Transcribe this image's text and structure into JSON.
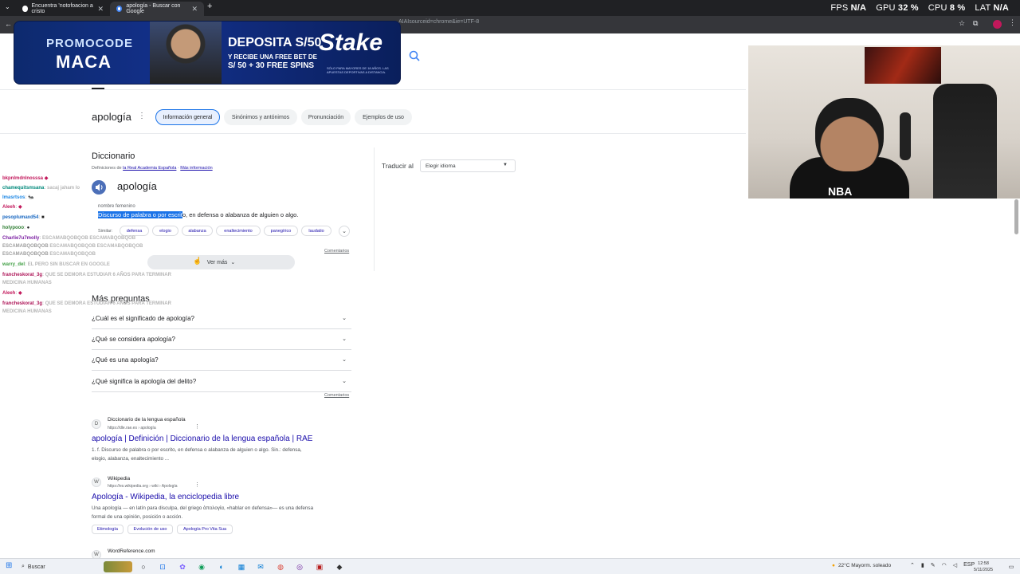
{
  "browser": {
    "tabs": [
      {
        "title": "Encuentra 'notofoacion a cristo",
        "active": false
      },
      {
        "title": "apología - Buscar con Google",
        "active": true
      }
    ],
    "url_fragment": "AIAIsourceid=chrome&ie=UTF-8"
  },
  "stats": {
    "fps_label": "FPS",
    "fps_value": "N/A",
    "gpu_label": "GPU",
    "gpu_value": "32 %",
    "cpu_label": "CPU",
    "cpu_value": "8 %",
    "lat_label": "LAT",
    "lat_value": "N/A"
  },
  "ad": {
    "promo_line1": "PROMOCODE",
    "promo_line2": "MACA",
    "deposit": "DEPOSITA S/50",
    "bonus_line1": "Y RECIBE UNA FREE BET DE",
    "bonus_line2": "S/ 50 + 30 FREE SPINS",
    "brand": "Stake",
    "fine_print": "SÓLO PARA MAYORES DE 18 AÑOS. LAS APUESTAS DEPORTIVAS A DISTANCIA."
  },
  "search": {
    "query": "apología",
    "chips": [
      "Información general",
      "Sinónimos y antónimos",
      "Pronunciación",
      "Ejemplos de uso"
    ],
    "selected_chip": "Información general"
  },
  "dictionary": {
    "title": "Diccionario",
    "source_prefix": "Definiciones de",
    "source_link": "la Real Academia Española",
    "more_info": "Más información",
    "headword": "apología",
    "part_of_speech": "nombre femenino",
    "definition_highlight": "Discurso de palabra o por escrit",
    "definition_rest": "o, en defensa o alabanza de alguien o algo.",
    "similar_label": "Similar:",
    "synonyms": [
      "defensa",
      "elogio",
      "alabanza",
      "enaltecimiento",
      "panegírico",
      "laudatio"
    ],
    "comments": "Comentarios",
    "see_more": "Ver más"
  },
  "translate": {
    "label": "Traducir al",
    "placeholder": "Elegir idioma"
  },
  "more_questions": {
    "title": "Más preguntas",
    "items": [
      "¿Cuál es el significado de apología?",
      "¿Qué se considera apología?",
      "¿Qué es una apología?",
      "¿Qué significa la apología del delito?"
    ],
    "comments": "Comentarios"
  },
  "results": [
    {
      "site": "Diccionario de la lengua española",
      "url": "https://dle.rae.es › apología",
      "title": "apología | Definición | Diccionario de la lengua española | RAE",
      "snippet_line1": "1. f. Discurso de palabra o por escrito, en defensa o alabanza de alguien o algo. Sin.: defensa,",
      "snippet_line2": "elogio, alabanza, enaltecimiento ..."
    },
    {
      "site": "Wikipedia",
      "url": "https://es.wikipedia.org › wiki › Apología",
      "title": "Apología - Wikipedia, la enciclopedia libre",
      "snippet_line1": "Una apología — en latín para disculpa, del griego ἀπολογία, «hablar en defensa»— es una defensa",
      "snippet_line2": "formal de una opinión, posición o acción.",
      "chips": [
        "Etimología",
        "Evolución de uso",
        "Apología Pro Vita Sua"
      ]
    },
    {
      "site": "WordReference.com"
    }
  ],
  "chat": [
    {
      "user": "bkpnlmdnlnosssa",
      "msg": "",
      "color": "#c2185b"
    },
    {
      "user": "chamequitsmsana",
      "msg": ": sacaj jaham lo",
      "color": "#00897b"
    },
    {
      "user": "Imasrtsos",
      "msg": ": 🐜",
      "color": "#1e88e5"
    },
    {
      "user": "Aleeh",
      "msg": ":",
      "color": "#c2185b"
    },
    {
      "user": "pesoplumaxd54",
      "msg": ":",
      "color": "#1565c0"
    },
    {
      "user": "holypooo",
      "msg": ":",
      "color": "#2e7d32"
    },
    {
      "user": "Charlie7u7molly",
      "msg": ": ESCAMABQOBQOB ESCAMABQOBQOB",
      "color": "#7b1fa2"
    },
    {
      "user": "ESCAMABQOBQOB",
      "msg": "ESCAMABQOBQOB ESCAMABQOBQOB",
      "color": "#9e9e9e"
    },
    {
      "user": "ESCAMABQOBQOB",
      "msg": "ESCAMABQOBQOB",
      "color": "#9e9e9e"
    },
    {
      "user": "warry_del",
      "msg": ": EL PERO SIN BUSCAR EN GOOGLE",
      "color": "#43a047"
    },
    {
      "user": "francheskorat_3g",
      "msg": ": QUE SE DEMORA ESTUDIAR 6 AÑOS PARA TERMINAR",
      "color": "#ad1457"
    },
    {
      "user": "",
      "msg": "MEDICINA HUMANAS",
      "color": "#9e9e9e"
    },
    {
      "user": "Aleeh",
      "msg": ":",
      "color": "#c2185b"
    },
    {
      "user": "francheskorat_3g",
      "msg": ": QUE SE DEMORA ESTUDIAR 6 AÑOS PARA TERMINAR",
      "color": "#ad1457"
    },
    {
      "user": "",
      "msg": "MEDICINA HUMANAS",
      "color": "#9e9e9e"
    }
  ],
  "taskbar": {
    "search_placeholder": "Buscar",
    "weather": "22°C  Mayorm. soleado",
    "lang": "ESP",
    "time": "12:58",
    "date": "5/11/2025"
  }
}
